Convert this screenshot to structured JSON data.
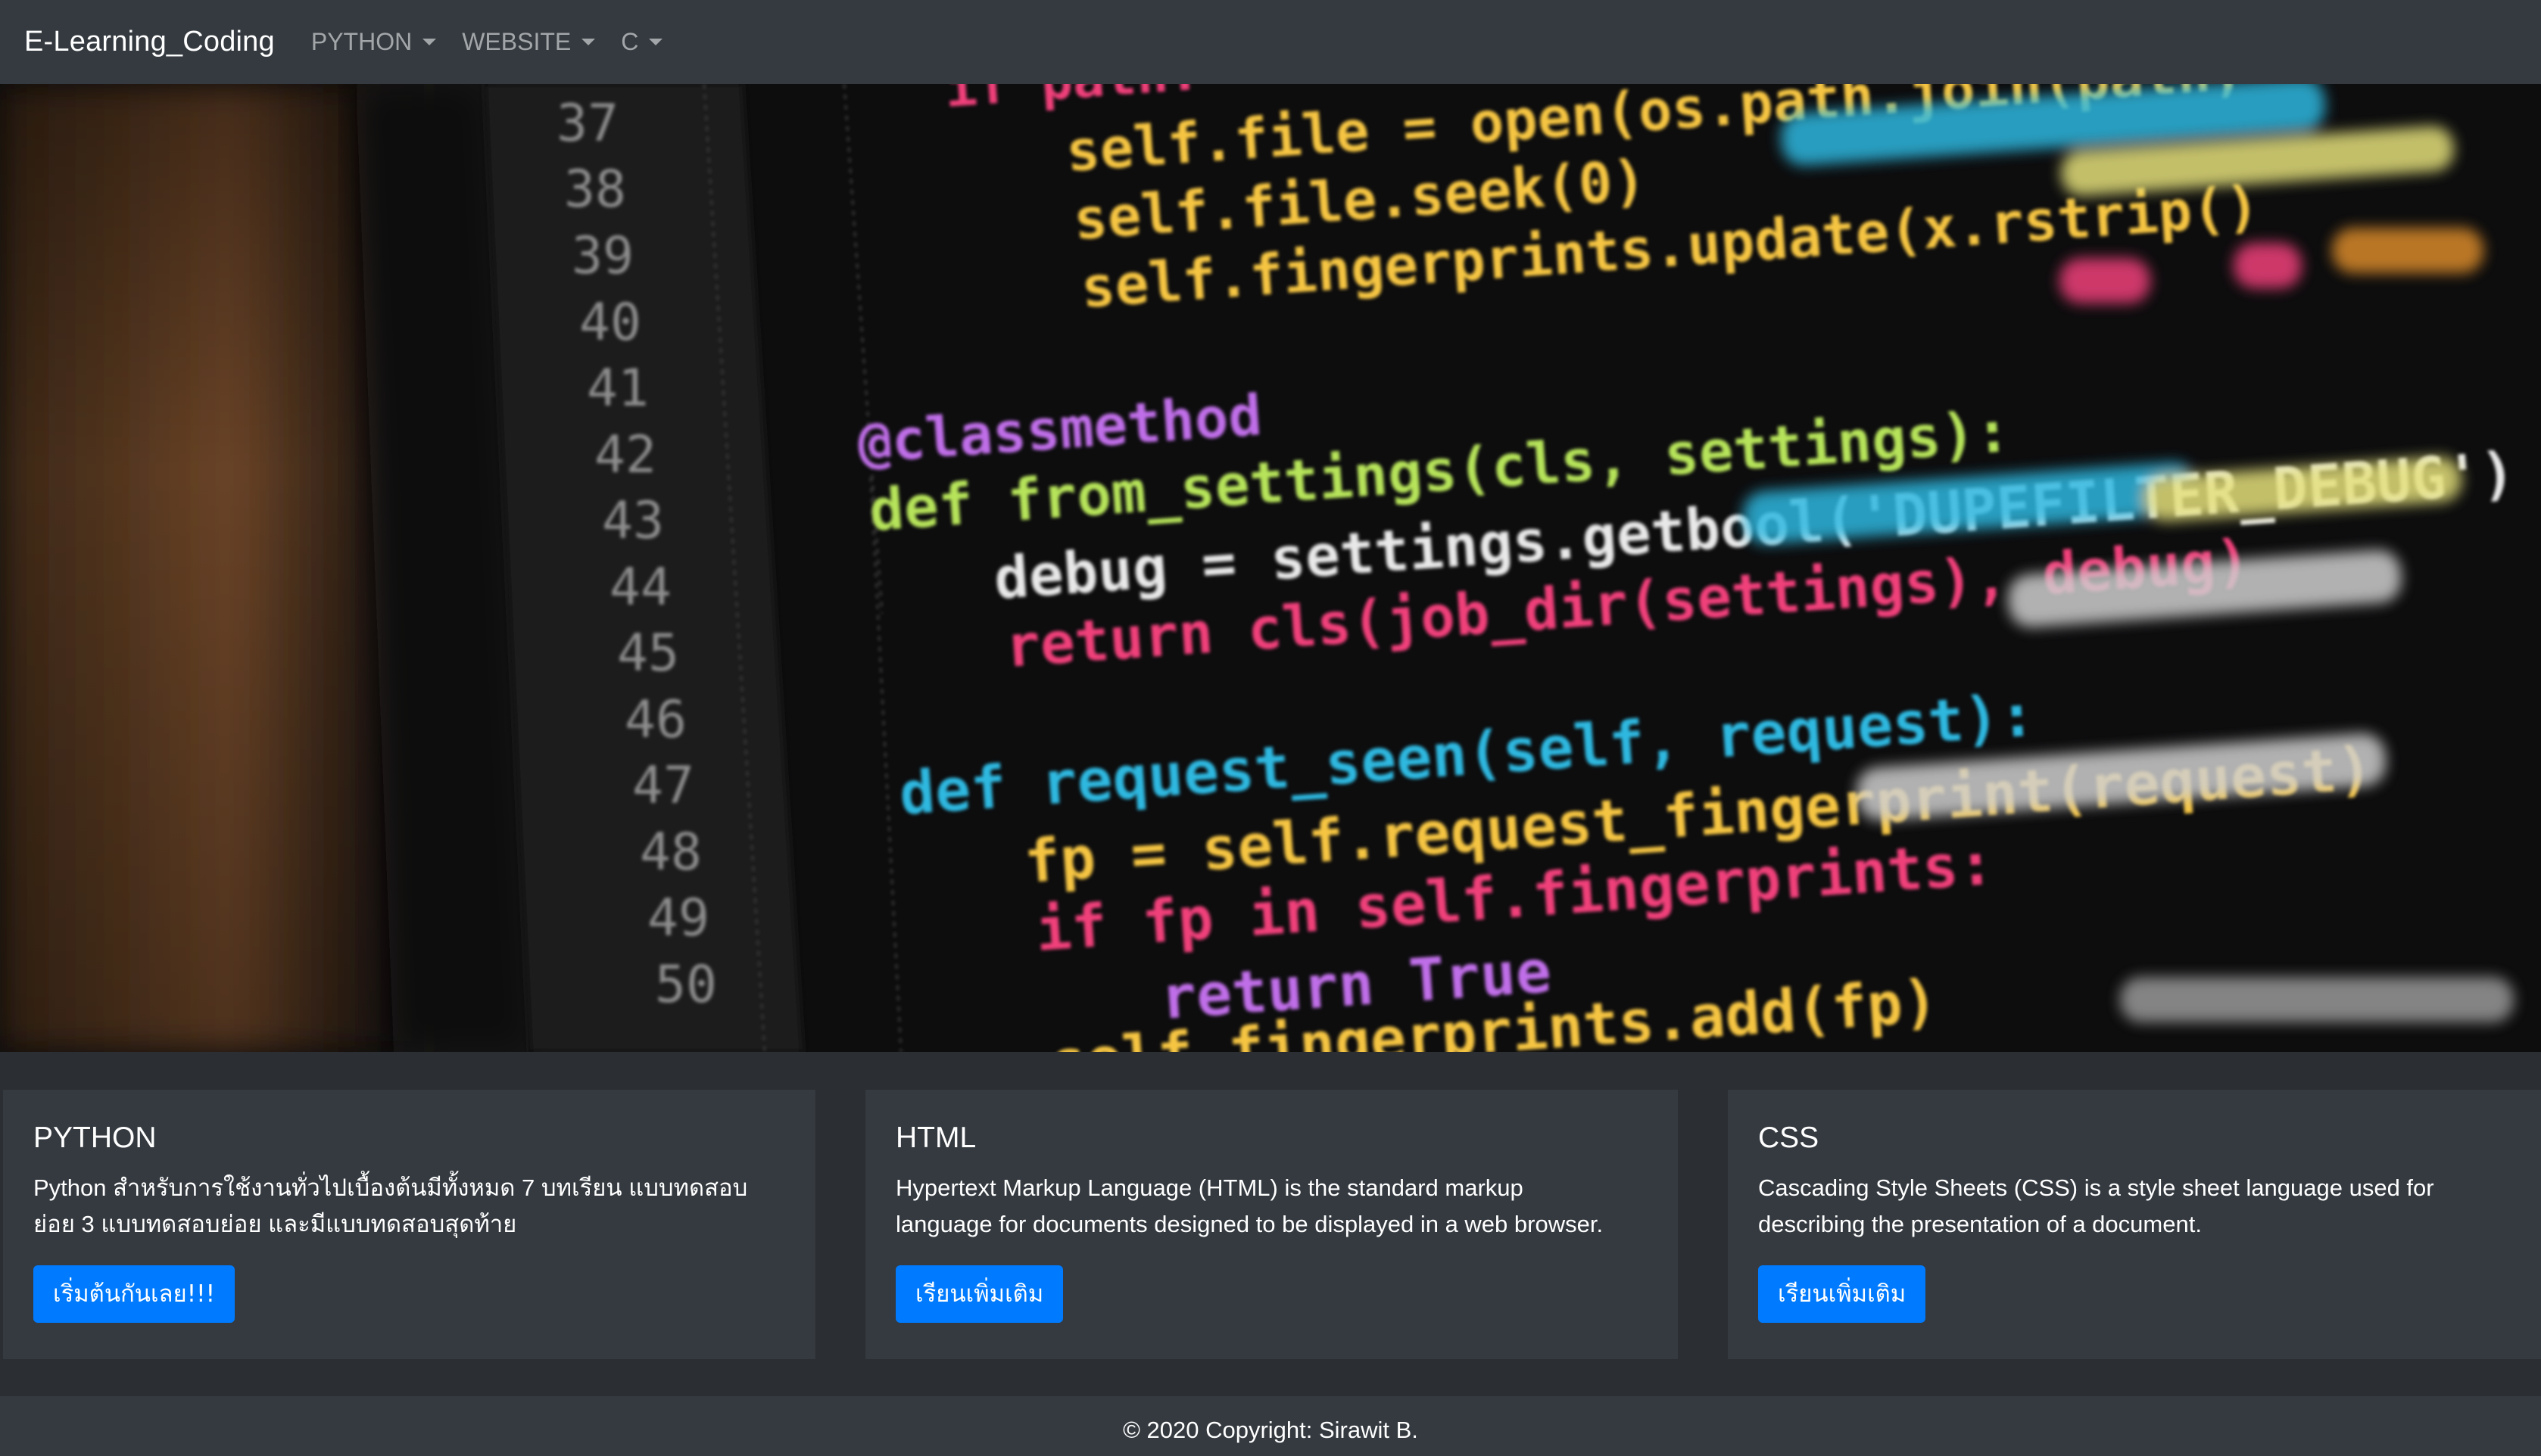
{
  "navbar": {
    "brand": "E-Learning_Coding",
    "items": [
      {
        "label": "PYTHON"
      },
      {
        "label": "WEBSITE"
      },
      {
        "label": "C"
      }
    ]
  },
  "hero": {
    "line_numbers": [
      "37",
      "38",
      "39",
      "40",
      "41",
      "42",
      "43",
      "44",
      "45",
      "46",
      "47",
      "48",
      "49",
      "50"
    ],
    "code": {
      "l36": "if path:",
      "l37": "self.file = open(os.path.join(path,",
      "l38": "self.file.seek(0)",
      "l39": "self.fingerprints.update(x.rstrip()",
      "l41": "@classmethod",
      "l42": "def from_settings(cls, settings):",
      "l43": "debug = settings.getbool('DUPEFILTER_DEBUG')",
      "l44": "return cls(job_dir(settings), debug)",
      "l46": "def request_seen(self, request):",
      "l47": "fp = self.request_fingerprint(request)",
      "l48": "if fp in self.fingerprints:",
      "l49": "return True",
      "l50": "self.fingerprints.add(fp)"
    }
  },
  "cards": [
    {
      "title": "PYTHON",
      "text_line1": "Python สำหรับการใช้งานทั่วไปเบื้องต้นมีทั้งหมด 7 บทเรียน แบบทดสอบ",
      "text_line2": "ย่อย 3 แบบทดสอบย่อย และมีแบบทดสอบสุดท้าย",
      "button": "เริ่มต้นกันเลย!!!"
    },
    {
      "title": "HTML",
      "text_line1": "Hypertext Markup Language (HTML) is the standard markup",
      "text_line2": "language for documents designed to be displayed in a web browser.",
      "button": "เรียนเพิ่มเติม"
    },
    {
      "title": "CSS",
      "text_line1": "Cascading Style Sheets (CSS) is a style sheet language used for",
      "text_line2": "describing the presentation of a document.",
      "button": "เรียนเพิ่มเติม"
    }
  ],
  "footer": {
    "text": "© 2020 Copyright: Sirawit B."
  },
  "colors": {
    "navbar_bg": "#343a40",
    "page_bg": "#2b2e32",
    "card_bg": "#343a40",
    "button_bg": "#007bff",
    "code_yellow": "#f5c542",
    "code_cyan": "#2fb8e0",
    "code_pink": "#f0407a",
    "code_white": "#e8e8e8",
    "code_green": "#b6e35a",
    "code_purple": "#c06ee8"
  }
}
